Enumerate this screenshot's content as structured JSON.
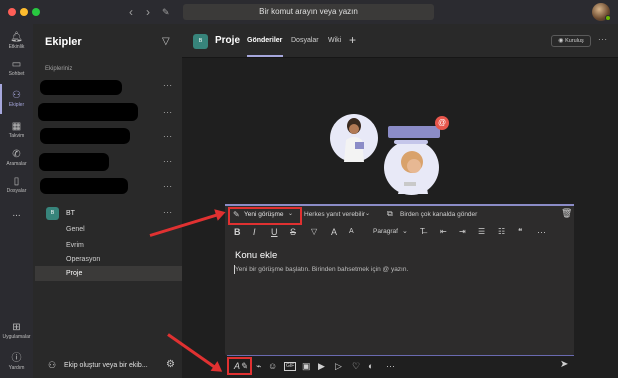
{
  "titlebar": {
    "search_placeholder": "Bir komut arayın veya yazın",
    "back_icon": "chevron-left",
    "forward_icon": "chevron-right",
    "compose_icon": "edit"
  },
  "rail": {
    "items": [
      {
        "label": "Etkinlik",
        "icon": "bell"
      },
      {
        "label": "Sohbet",
        "icon": "chat"
      },
      {
        "label": "Ekipler",
        "icon": "people",
        "active": true
      },
      {
        "label": "Takvim",
        "icon": "calendar"
      },
      {
        "label": "Aramalar",
        "icon": "phone"
      },
      {
        "label": "Dosyalar",
        "icon": "file"
      },
      {
        "label": "...",
        "icon": "more"
      }
    ],
    "apps_label": "Uygulamalar",
    "help_label": "Yardım"
  },
  "teams": {
    "title": "Ekipler",
    "section_label": "Ekipleriniz",
    "team_bt": {
      "initials": "B",
      "name": "BT",
      "channels": [
        "Genel",
        "Evrim",
        "Operasyon",
        "Proje"
      ],
      "selected_channel": "Proje"
    },
    "join_label": "Ekip oluştur veya bir ekib..."
  },
  "header": {
    "avatar_initials": "B",
    "channel_name": "Proje",
    "tabs": [
      "Gönderiler",
      "Dosyalar",
      "Wiki"
    ],
    "active_tab": "Gönderiler",
    "add_tab": "+",
    "org_button": "Kuruluş"
  },
  "compose": {
    "post_type": "Yeni görüşme",
    "reply_setting": "Herkes yanıt verebilir",
    "multi_channel": "Birden çok kanalda gönder",
    "paragraph": "Paragraf",
    "subject_placeholder": "Konu ekle",
    "body_placeholder": "Yeni bir görüşme başlatın. Birinden bahsetmek için @ yazın.",
    "format_buttons": [
      "B",
      "I",
      "U",
      "S",
      "▽",
      "A",
      "A",
      "",
      "",
      "",
      "",
      "",
      "",
      "",
      "···"
    ],
    "tools": [
      "format",
      "attach",
      "emoji",
      "gif",
      "sticker",
      "meet",
      "send-later",
      "praise",
      "stream",
      "loop",
      "more",
      "send"
    ]
  },
  "colors": {
    "accent": "#a6a7dc",
    "highlight_red": "#e03131",
    "team_avatar": "#37847b"
  }
}
